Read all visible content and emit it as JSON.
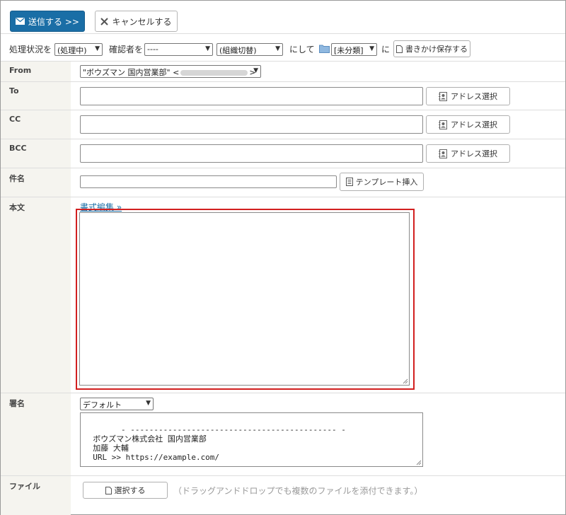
{
  "toolbar": {
    "send_label": "送信する >>",
    "cancel_label": "キャンセルする"
  },
  "options": {
    "status_prefix": "処理状況を",
    "status_value": "(処理中)",
    "confirmer_prefix": "確認者を",
    "confirmer_value": "----",
    "org_value": "(組織切替)",
    "folder_prefix": "にして",
    "folder_value": "[未分類]",
    "folder_suffix": "に",
    "save_draft_label": "書きかけ保存する"
  },
  "form": {
    "from_label": "From",
    "from_value": "\"ボウズマン 国内営業部\" <",
    "from_value_end": ">",
    "to_label": "To",
    "cc_label": "CC",
    "bcc_label": "BCC",
    "address_select_label": "アドレス選択",
    "subject_label": "件名",
    "template_label": "テンプレート挿入",
    "body_label": "本文",
    "format_edit_link": "書式編集 »",
    "signature_label": "署名",
    "signature_select": "デフォルト",
    "signature_text": "- -------------------------------------------- -\n  ボウズマン株式会社 国内営業部\n  加藤 大輔\n  URL >> https://example.com/\n- -------------------------------------------- -",
    "file_label": "ファイル",
    "file_select_label": "選択する",
    "file_hint": "（ドラッグアンドドロップでも複数のファイルを添付できます。）"
  },
  "colors": {
    "primary": "#1a6ea6",
    "highlight": "#d21f1f",
    "label_bg": "#f5f4ef"
  }
}
